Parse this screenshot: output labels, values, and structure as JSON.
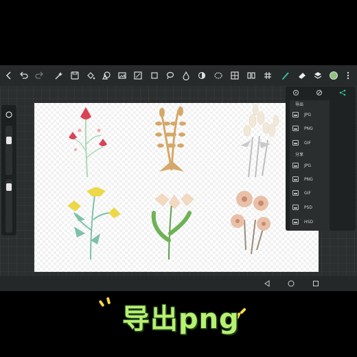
{
  "app": {
    "colors": {
      "background": "#2b2f2f",
      "toolbar": "#262a2a",
      "accent": "#35c2a0",
      "canvas": "#ffffff"
    },
    "toolbar": {
      "icons": [
        "back-icon",
        "undo-icon",
        "redo-icon",
        "magic-wand-icon",
        "save-icon",
        "fill-bucket-icon",
        "shapes-icon",
        "image-icon",
        "adjust-icon",
        "crop-icon",
        "lasso-icon",
        "drop-icon",
        "blur-icon",
        "selection-icon",
        "transform-icon",
        "symmetry-icon",
        "grid-icon",
        "pen-icon",
        "eraser-icon",
        "layers-icon",
        "color-icon",
        "more-icon"
      ]
    },
    "menu": {
      "export_section": "导出",
      "export_items": [
        "JPG",
        "PNG",
        "GIF"
      ],
      "share_section": "分享",
      "share_items": [
        "JPG",
        "PNG",
        "GIF",
        "PSD",
        "HSD"
      ]
    },
    "canvas_text": "— —"
  },
  "caption": {
    "text": "导出png",
    "color": "#b8f070"
  }
}
